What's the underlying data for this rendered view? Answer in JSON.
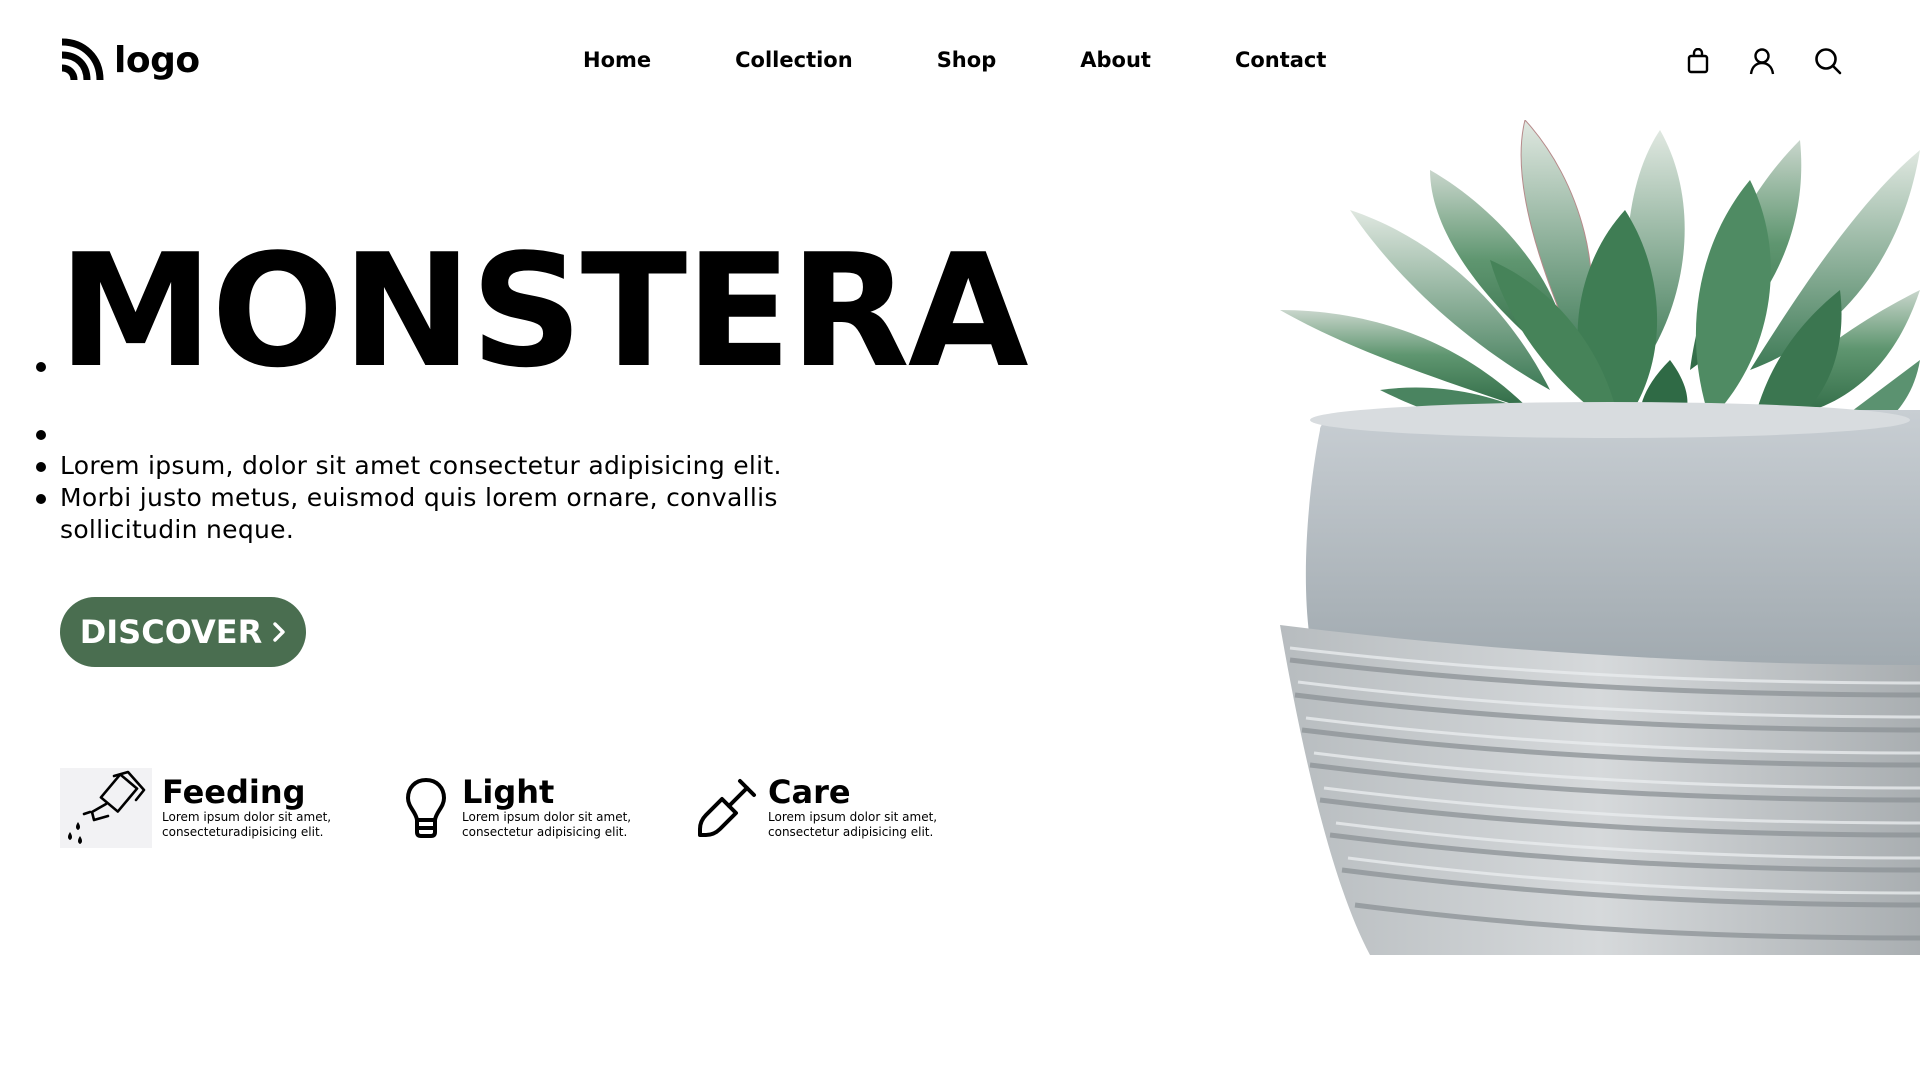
{
  "header": {
    "logo_text": "logo",
    "nav": [
      "Home",
      "Collection",
      "Shop",
      "About",
      "Contact"
    ],
    "icons": [
      "bag-icon",
      "user-icon",
      "search-icon"
    ]
  },
  "hero": {
    "title": "MONSTERA",
    "line1": "Lorem ipsum, dolor sit amet consectetur adipisicing elit.",
    "line2": "Morbi justo metus, euismod quis lorem ornare, convallis sollicitudin neque.",
    "button_label": "DISCOVER"
  },
  "features": [
    {
      "title": "Feeding",
      "desc": "Lorem ipsum dolor sit amet, consecteturadipisicing elit.",
      "icon": "watering-can-icon"
    },
    {
      "title": "Light",
      "desc": "Lorem ipsum dolor sit amet, consectetur adipisicing elit.",
      "icon": "lightbulb-icon"
    },
    {
      "title": "Care",
      "desc": "Lorem ipsum dolor sit amet, consectetur adipisicing elit.",
      "icon": "shovel-icon"
    }
  ],
  "colors": {
    "accent": "#4a6e50",
    "text": "#000000",
    "background": "#ffffff"
  }
}
